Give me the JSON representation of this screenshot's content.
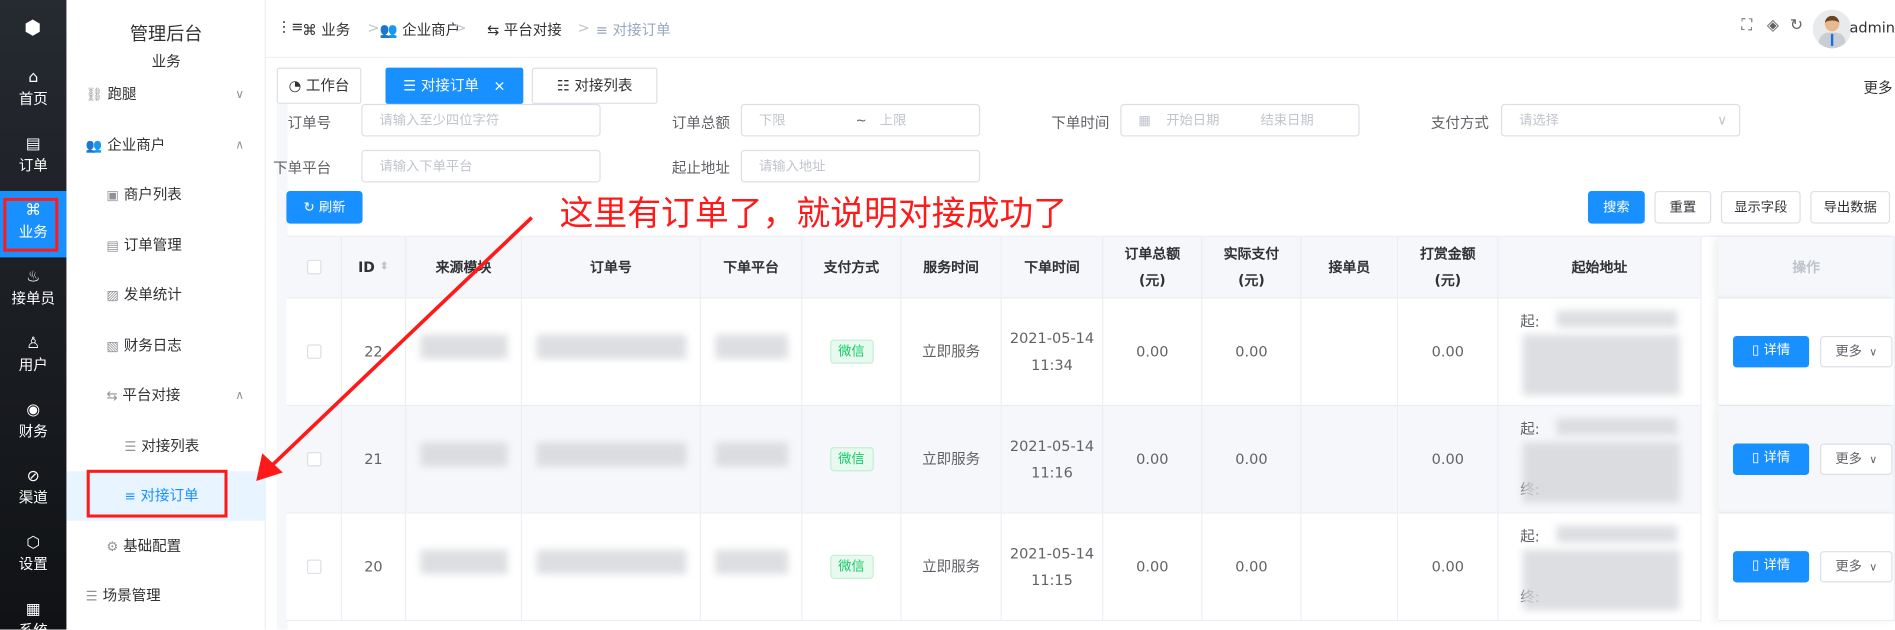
{
  "rail": [
    {
      "label": "首页",
      "icon": "home-icon",
      "glyph": "⌂"
    },
    {
      "label": "订单",
      "icon": "order-icon",
      "glyph": "▤"
    },
    {
      "label": "业务",
      "icon": "business-icon",
      "glyph": "⌘",
      "active": true
    },
    {
      "label": "接单员",
      "icon": "rider-icon",
      "glyph": "♨"
    },
    {
      "label": "用户",
      "icon": "user-icon",
      "glyph": "♙"
    },
    {
      "label": "财务",
      "icon": "finance-icon",
      "glyph": "◉"
    },
    {
      "label": "渠道",
      "icon": "channel-icon",
      "glyph": "⊘"
    },
    {
      "label": "设置",
      "icon": "settings-icon",
      "glyph": "⬡"
    },
    {
      "label": "系统",
      "icon": "system-icon",
      "glyph": "▦"
    }
  ],
  "sidebar": {
    "title": "管理后台",
    "subtitle": "业务",
    "items": [
      {
        "label": "跑腿",
        "icon": "errand-icon",
        "glyph": "⛓",
        "chev": "∨",
        "level": 1
      },
      {
        "label": "企业商户",
        "icon": "merchant-icon",
        "glyph": "👥",
        "chev": "∧",
        "level": 1
      },
      {
        "label": "商户列表",
        "icon": "list-icon",
        "glyph": "▣",
        "level": 2
      },
      {
        "label": "订单管理",
        "icon": "order-manage-icon",
        "glyph": "▤",
        "level": 2
      },
      {
        "label": "发单统计",
        "icon": "stats-icon",
        "glyph": "▨",
        "level": 2
      },
      {
        "label": "财务日志",
        "icon": "log-icon",
        "glyph": "▧",
        "level": 2
      },
      {
        "label": "平台对接",
        "icon": "transfer-icon",
        "glyph": "⇆",
        "chev": "∧",
        "level": 2
      },
      {
        "label": "对接列表",
        "icon": "list-icon",
        "glyph": "☰",
        "level": 3
      },
      {
        "label": "对接订单",
        "icon": "order-list-icon",
        "glyph": "≡",
        "level": 3,
        "active": true
      },
      {
        "label": "基础配置",
        "icon": "gear-icon",
        "glyph": "⚙",
        "level": 2
      },
      {
        "label": "场景管理",
        "icon": "scene-icon",
        "glyph": "☰",
        "level": 1
      }
    ]
  },
  "header": {
    "breadcrumb": [
      "业务",
      "企业商户",
      "平台对接",
      "对接订单"
    ],
    "user": "admin"
  },
  "tabs": [
    {
      "label": "工作台",
      "icon": "dashboard-icon"
    },
    {
      "label": "对接订单",
      "icon": "list-icon",
      "active": true
    },
    {
      "label": "对接列表",
      "icon": "list-icon"
    }
  ],
  "tabs_more": "更多",
  "filters": {
    "order_no": {
      "label": "订单号",
      "placeholder": "请输入至少四位字符"
    },
    "total": {
      "label": "订单总额",
      "min": "下限",
      "max": "上限",
      "sep": "~"
    },
    "time": {
      "label": "下单时间",
      "start": "开始日期",
      "end": "结束日期"
    },
    "pay": {
      "label": "支付方式",
      "placeholder": "请选择"
    },
    "platform": {
      "label": "下单平台",
      "placeholder": "请输入下单平台"
    },
    "address": {
      "label": "起止地址",
      "placeholder": "请输入地址"
    }
  },
  "buttons": {
    "refresh": "刷新",
    "search": "搜索",
    "reset": "重置",
    "fields": "显示字段",
    "export": "导出数据"
  },
  "annotation": "这里有订单了，就说明对接成功了",
  "table": {
    "columns": [
      "ID",
      "来源模块",
      "订单号",
      "下单平台",
      "支付方式",
      "服务时间",
      "下单时间",
      "订单总额(元)",
      "实际支付(元)",
      "接单员",
      "打赏金额(元)",
      "起始地址",
      "操作"
    ],
    "rows": [
      {
        "id": "22",
        "pay": "微信",
        "service": "立即服务",
        "date": "2021-05-14",
        "time": "11:34",
        "total": "0.00",
        "paid": "0.00",
        "tip": "0.00",
        "from": "起:"
      },
      {
        "id": "21",
        "pay": "微信",
        "service": "立即服务",
        "date": "2021-05-14",
        "time": "11:16",
        "total": "0.00",
        "paid": "0.00",
        "tip": "0.00",
        "from": "起:",
        "to": "终:"
      },
      {
        "id": "20",
        "pay": "微信",
        "service": "立即服务",
        "date": "2021-05-14",
        "time": "11:15",
        "total": "0.00",
        "paid": "0.00",
        "tip": "0.00",
        "from": "起:",
        "to": "终:"
      }
    ],
    "detail": "详情",
    "more": "更多"
  },
  "colors": {
    "primary": "#1890ff",
    "annotation": "#ff1a1a",
    "tag": "#13ce66"
  }
}
